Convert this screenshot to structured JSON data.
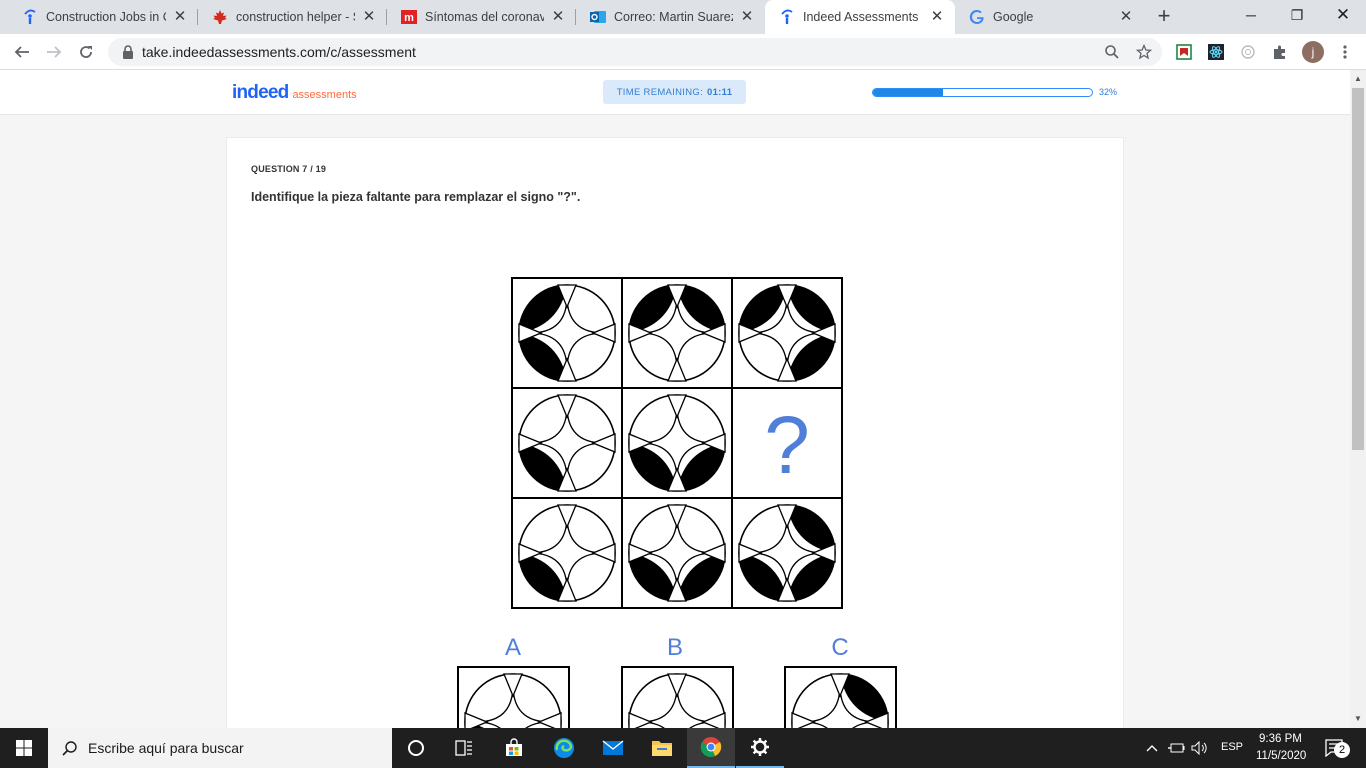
{
  "browser": {
    "tabs": [
      {
        "title": "Construction Jobs in Ca",
        "favicon": "indeed-icon",
        "active": false
      },
      {
        "title": "construction helper - Su",
        "favicon": "maple-leaf-icon",
        "active": false
      },
      {
        "title": "Síntomas del coronaviru",
        "favicon": "m-icon",
        "active": false
      },
      {
        "title": "Correo: Martin Suarez -",
        "favicon": "outlook-icon",
        "active": false
      },
      {
        "title": "Indeed Assessments",
        "favicon": "indeed-icon",
        "active": true
      },
      {
        "title": "Google",
        "favicon": "google-icon",
        "active": false
      }
    ],
    "new_tab_label": "+",
    "url": "take.indeedassessments.com/c/assessment",
    "profile_initial": "j"
  },
  "page": {
    "logo_main": "indeed",
    "logo_sub": "assessments",
    "timer_label": "TIME REMAINING:",
    "timer_value": "01:11",
    "progress_percent": 32,
    "progress_label": "32%",
    "question_counter": "QUESTION 7 / 19",
    "question_text": "Identifique la pieza faltante para remplazar el signo \"?\".",
    "missing_marker": "?",
    "options": [
      "A",
      "B",
      "C"
    ]
  },
  "taskbar": {
    "search_placeholder": "Escribe aquí para buscar",
    "language": "ESP",
    "time": "9:36 PM",
    "date": "11/5/2020",
    "notification_count": "2"
  },
  "colors": {
    "accent_blue": "#2164f3",
    "timer_bg": "#dbeafb",
    "progress_fill": "#1e88e5",
    "option_letter": "#4f7fd9"
  }
}
